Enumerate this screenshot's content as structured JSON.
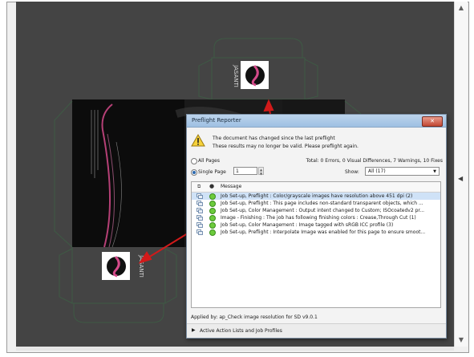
{
  "artwork": {
    "brand": "JASANTI"
  },
  "colors": {
    "canvas": "#444444",
    "box_fill": "#0c0c0c",
    "dieline": "#3e5a45",
    "arrow": "#d11a1a",
    "accent_pink": "#d54a8a"
  },
  "dialog": {
    "title": "Preflight Reporter",
    "close_icon": "close-icon",
    "warning_line1": "The document has changed since the last preflight",
    "warning_line2": "These results may no longer be valid. Please preflight again.",
    "all_pages_label": "All Pages",
    "single_page_label": "Single Page",
    "page_value": "1",
    "totals": "Total: 0 Errors, 0 Visual Differences, 7 Warnings, 10 Fixes",
    "show_label": "Show:",
    "show_value": "All (17)",
    "list_header": {
      "message": "Message"
    },
    "rows": [
      {
        "text": "Job Set-up, Preflight : Color/grayscale images have resolution above 451 dpi (2)",
        "selected": true
      },
      {
        "text": "Job Set-up, Preflight : This page includes non-standard transparent objects, which ...",
        "selected": false
      },
      {
        "text": "Job Set-up, Color Management : Output intent changed to Custom; ISOcoatedv2 pr...",
        "selected": false
      },
      {
        "text": "Image - Finishing : The job has following finishing colors : Crease,Through Cut (1)",
        "selected": false
      },
      {
        "text": "Job Set-up, Color Management : Image tagged with sRGB ICC profile (3)",
        "selected": false
      },
      {
        "text": "Job Set-up, Preflight : Interpolate Image was enabled for this page to ensure smoot...",
        "selected": false
      }
    ],
    "applied_by": "Applied by: ap_Check image resolution for SD v9.0.1",
    "bottom_label": "Active Action Lists and Job Profiles"
  }
}
